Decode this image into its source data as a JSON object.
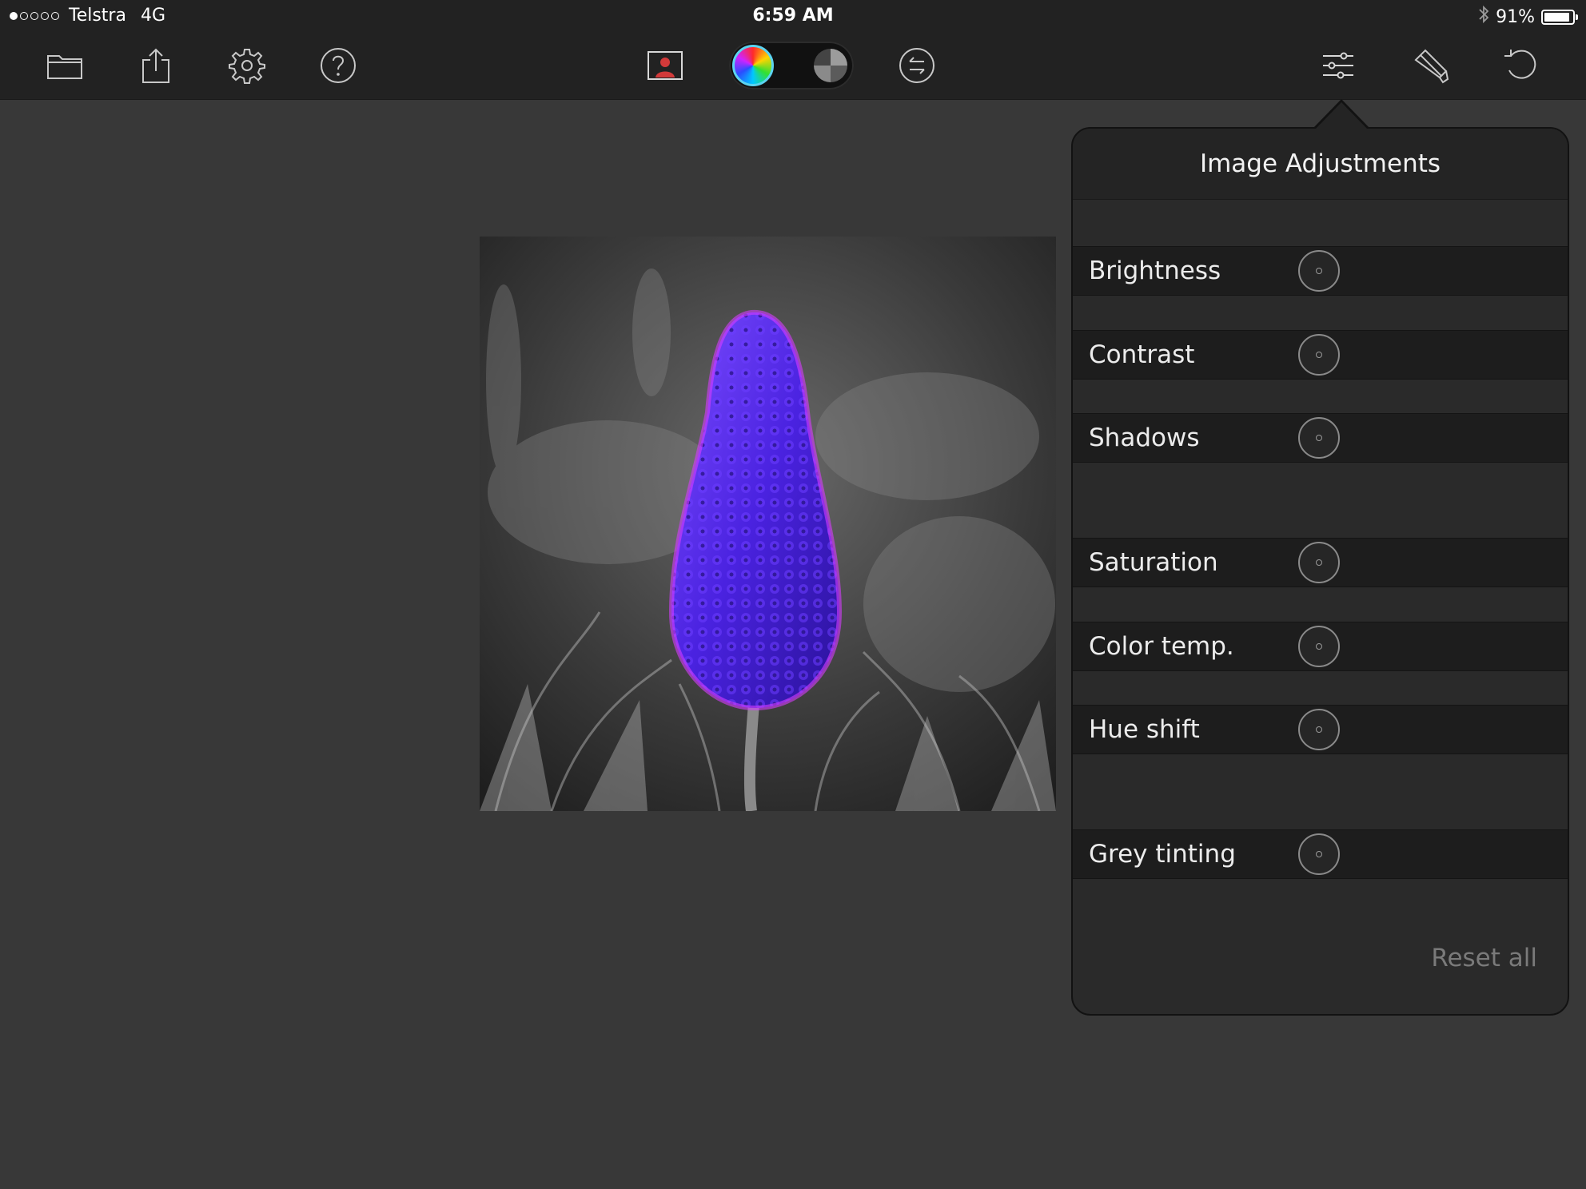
{
  "status_bar": {
    "carrier": "Telstra",
    "network": "4G",
    "signal_bars_total": 5,
    "signal_bars_filled": 1,
    "time": "6:59 AM",
    "bluetooth_icon": "bluetooth-icon",
    "battery_percent": "91%",
    "battery_level": 0.91
  },
  "toolbar": {
    "left_icons": [
      "folder-icon",
      "share-icon",
      "gear-icon",
      "help-icon"
    ],
    "center_icons": [
      "portrait-icon",
      "color-mode-icon",
      "grey-mode-icon",
      "swap-icon"
    ],
    "right_icons": [
      "sliders-icon",
      "brush-icon",
      "undo-icon"
    ],
    "accent": "#5bd3f0"
  },
  "popover": {
    "title": "Image Adjustments",
    "adjustments": [
      {
        "label": "Brightness"
      },
      {
        "label": "Contrast"
      },
      {
        "label": "Shadows"
      },
      {
        "label": "Saturation"
      },
      {
        "label": "Color temp."
      },
      {
        "label": "Hue shift"
      },
      {
        "label": "Grey tinting"
      }
    ],
    "reset_label": "Reset all"
  },
  "colors": {
    "background": "#383838",
    "bar": "#222222",
    "panel": "#2a2a2a",
    "flower": "#5a2cf0"
  }
}
